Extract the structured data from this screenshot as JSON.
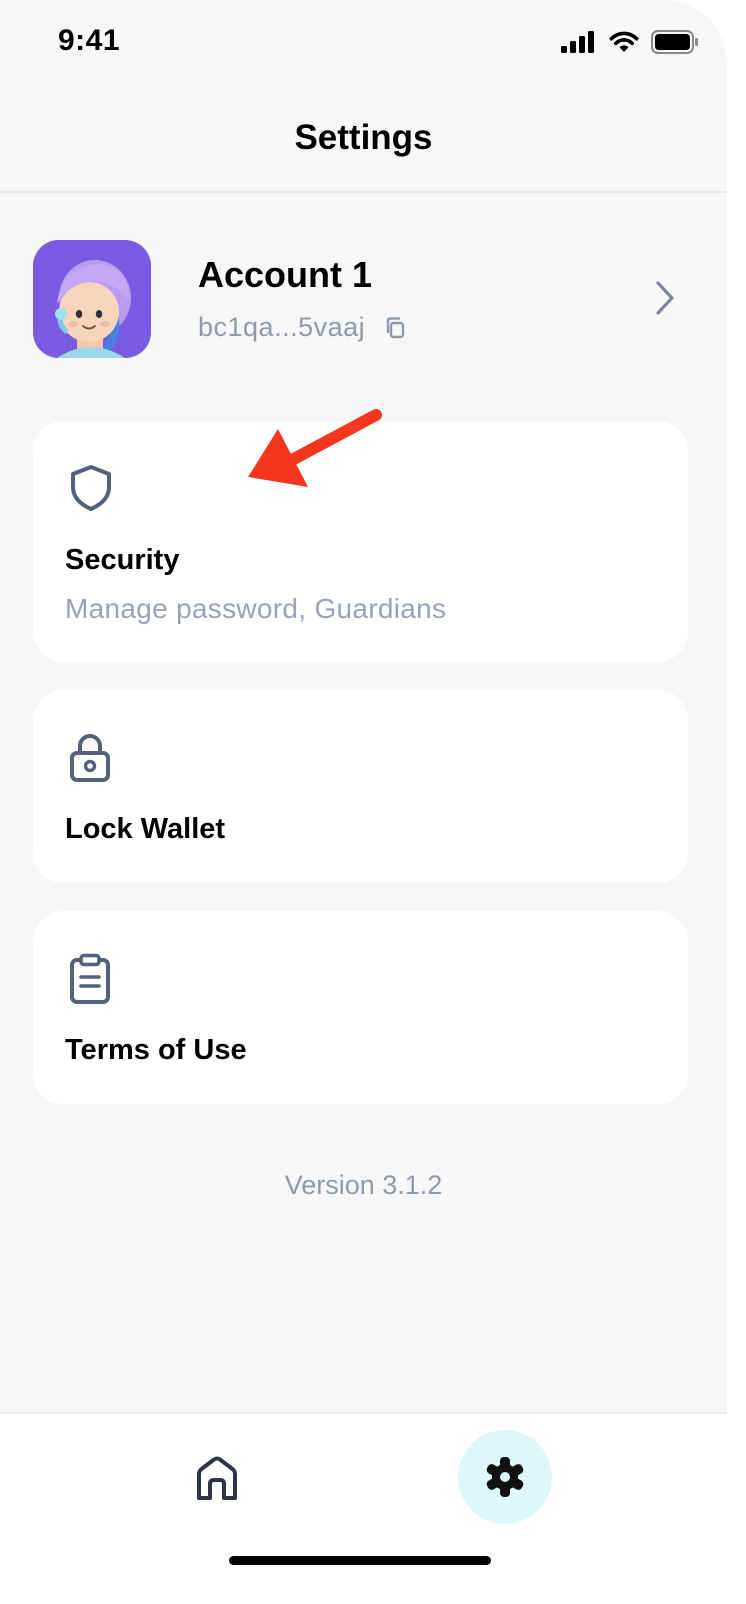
{
  "status_bar": {
    "time": "9:41"
  },
  "header": {
    "title": "Settings"
  },
  "account": {
    "name": "Account 1",
    "address": "bc1qa...5vaaj"
  },
  "menu": [
    {
      "icon": "shield-icon",
      "title": "Security",
      "subtitle": "Manage password, Guardians"
    },
    {
      "icon": "lock-icon",
      "title": "Lock Wallet"
    },
    {
      "icon": "clipboard-icon",
      "title": "Terms of Use"
    }
  ],
  "footer": {
    "version": "Version 3.1.2"
  },
  "tabbar": {
    "items": [
      {
        "icon": "home-icon",
        "active": false
      },
      {
        "icon": "settings-icon",
        "active": true
      }
    ]
  },
  "colors": {
    "background": "#f7f7f7",
    "card": "#ffffff",
    "avatar_bg": "#7a5ae0",
    "muted_text": "#8f9aac",
    "icon_slate": "#53617a",
    "annotation_arrow": "#f6371e",
    "active_tab_bg": "#def7fb"
  }
}
